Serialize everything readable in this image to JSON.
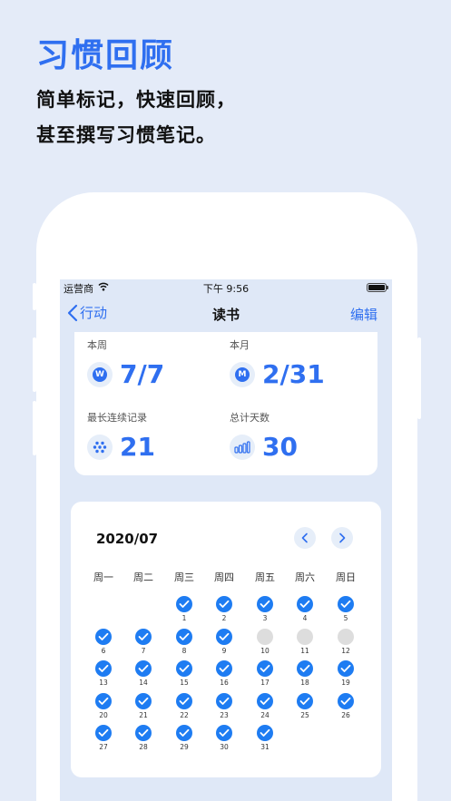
{
  "promo": {
    "title": "习惯回顾",
    "line1": "简单标记，快速回顾，",
    "line2": "甚至撰写习惯笔记。"
  },
  "status_bar": {
    "carrier": "运营商",
    "time": "下午 9:56"
  },
  "nav": {
    "back_label": "行动",
    "title": "读书",
    "edit_label": "编辑"
  },
  "stats": {
    "week": {
      "label": "本周",
      "badge": "W",
      "value": "7/7"
    },
    "month": {
      "label": "本月",
      "badge": "M",
      "value": "2/31"
    },
    "streak": {
      "label": "最长连续记录",
      "value": "21"
    },
    "total": {
      "label": "总计天数",
      "value": "30"
    }
  },
  "calendar": {
    "month": "2020/07",
    "weekdays": [
      "周一",
      "周二",
      "周三",
      "周四",
      "周五",
      "周六",
      "周日"
    ],
    "first_weekday_index": 2,
    "days_in_month": 31,
    "missed_days": [
      10,
      11,
      12
    ]
  },
  "colors": {
    "accent": "#2f6ff0",
    "done": "#1e7cf2",
    "missed": "#dddddd"
  }
}
